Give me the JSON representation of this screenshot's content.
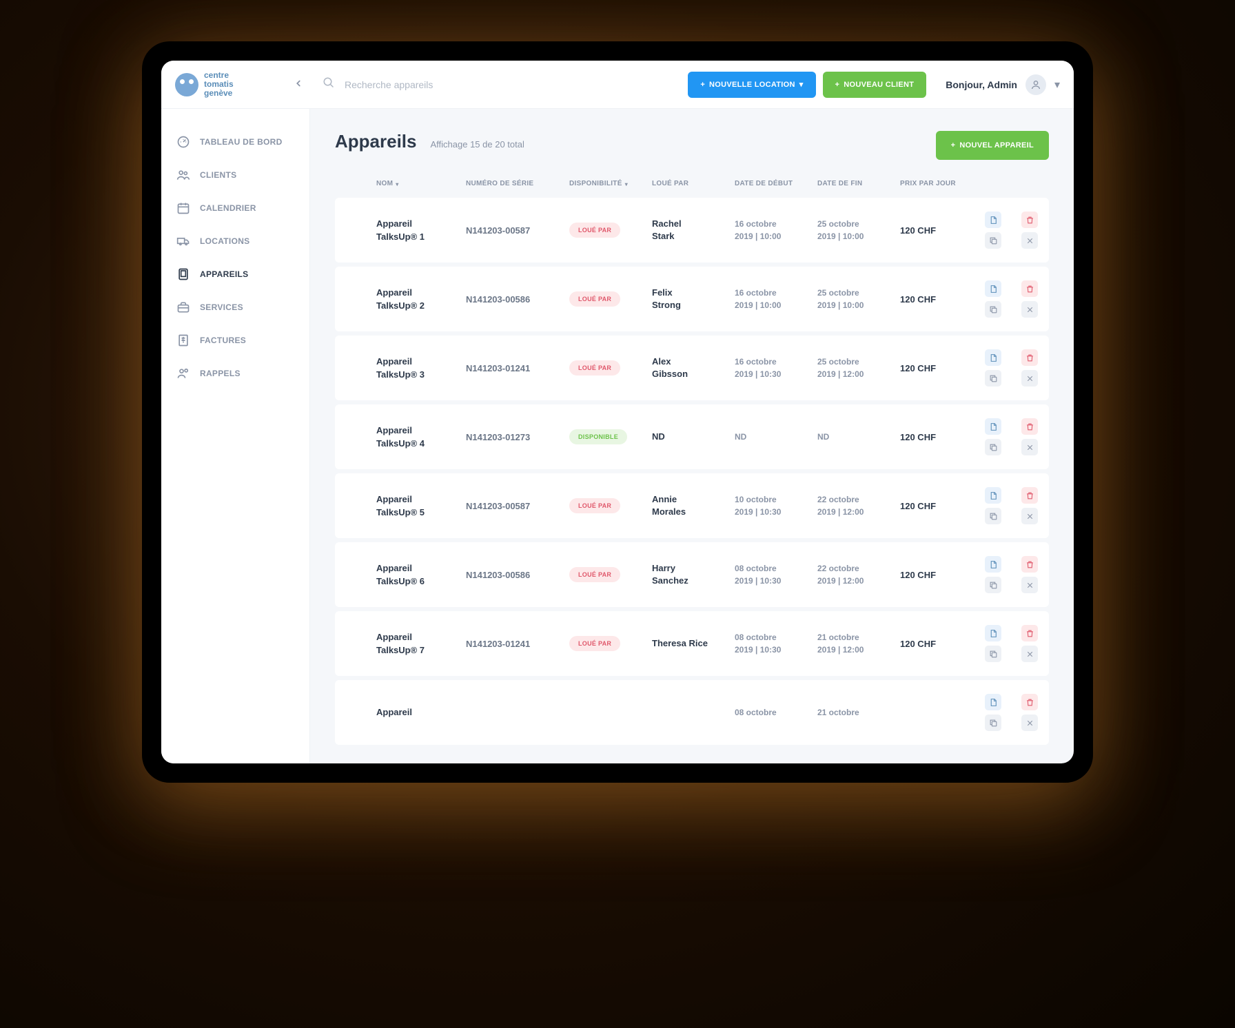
{
  "brand": {
    "line1": "centre",
    "line2": "tomatis",
    "line3": "genève"
  },
  "search": {
    "placeholder": "Recherche appareils"
  },
  "header_buttons": {
    "new_location": "NOUVELLE LOCATION",
    "new_client": "NOUVEAU CLIENT",
    "new_device": "NOUVEL APPAREIL"
  },
  "user": {
    "greeting": "Bonjour, Admin"
  },
  "sidebar": {
    "items": [
      {
        "label": "TABLEAU DE BORD",
        "icon": "dashboard"
      },
      {
        "label": "CLIENTS",
        "icon": "users"
      },
      {
        "label": "CALENDRIER",
        "icon": "calendar"
      },
      {
        "label": "LOCATIONS",
        "icon": "truck"
      },
      {
        "label": "APPAREILS",
        "icon": "device",
        "active": true
      },
      {
        "label": "SERVICES",
        "icon": "briefcase"
      },
      {
        "label": "FACTURES",
        "icon": "invoice"
      },
      {
        "label": "RAPPELS",
        "icon": "bell"
      }
    ]
  },
  "page": {
    "title": "Appareils",
    "subtitle": "Affichage 15 de 20 total"
  },
  "columns": {
    "nom": "NOM",
    "serial": "NUMÉRO DE SÉRIE",
    "dispo": "DISPONIBILITÉ",
    "loue_par": "LOUÉ PAR",
    "date_debut": "DATE DE DÉBUT",
    "date_fin": "DATE DE FIN",
    "prix": "PRIX PAR JOUR"
  },
  "status_labels": {
    "loue": "LOUÉ PAR",
    "dispo": "DISPONIBLE"
  },
  "rows": [
    {
      "color": "#3bc14a",
      "name_l1": "Appareil",
      "name_l2": "TalksUp® 1",
      "serial": "N141203-00587",
      "status": "loue",
      "person_l1": "Rachel",
      "person_l2": "Stark",
      "start_l1": "16 octobre",
      "start_l2": "2019 | 10:00",
      "end_l1": "25 octobre",
      "end_l2": "2019 | 10:00",
      "price": "120 CHF"
    },
    {
      "color": "#f2870c",
      "name_l1": "Appareil",
      "name_l2": "TalksUp® 2",
      "serial": "N141203-00586",
      "status": "loue",
      "person_l1": "Felix",
      "person_l2": "Strong",
      "start_l1": "16 octobre",
      "start_l2": "2019 | 10:00",
      "end_l1": "25 octobre",
      "end_l2": "2019 | 10:00",
      "price": "120 CHF"
    },
    {
      "color": "#8e44ad",
      "name_l1": "Appareil",
      "name_l2": "TalksUp® 3",
      "serial": "N141203-01241",
      "status": "loue",
      "person_l1": "Alex",
      "person_l2": "Gibsson",
      "start_l1": "16 octobre",
      "start_l2": "2019 | 10:30",
      "end_l1": "25 octobre",
      "end_l2": "2019 | 12:00",
      "price": "120 CHF"
    },
    {
      "color": "#2196f3",
      "name_l1": "Appareil",
      "name_l2": "TalksUp® 4",
      "serial": "N141203-01273",
      "status": "dispo",
      "person_l1": "ND",
      "person_l2": "",
      "start_l1": "ND",
      "start_l2": "",
      "end_l1": "ND",
      "end_l2": "",
      "price": "120 CHF"
    },
    {
      "color": "#e74c3c",
      "name_l1": "Appareil",
      "name_l2": "TalksUp® 5",
      "serial": "N141203-00587",
      "status": "loue",
      "person_l1": "Annie",
      "person_l2": "Morales",
      "start_l1": "10 octobre",
      "start_l2": "2019 | 10:30",
      "end_l1": "22 octobre",
      "end_l2": "2019 | 12:00",
      "price": "120 CHF"
    },
    {
      "color": "#bdc3c7",
      "name_l1": "Appareil",
      "name_l2": "TalksUp® 6",
      "serial": "N141203-00586",
      "status": "loue",
      "person_l1": "Harry",
      "person_l2": "Sanchez",
      "start_l1": "08 octobre",
      "start_l2": "2019 | 10:30",
      "end_l1": "22 octobre",
      "end_l2": "2019 | 12:00",
      "price": "120 CHF"
    },
    {
      "color": "#f1c40f",
      "name_l1": "Appareil",
      "name_l2": "TalksUp® 7",
      "serial": "N141203-01241",
      "status": "loue",
      "person_l1": "Theresa Rice",
      "person_l2": "",
      "start_l1": "08 octobre",
      "start_l2": "2019 | 10:30",
      "end_l1": "21 octobre",
      "end_l2": "2019 | 12:00",
      "price": "120 CHF"
    },
    {
      "color": "#16a085",
      "name_l1": "Appareil",
      "name_l2": "",
      "serial": "",
      "status": "",
      "person_l1": "",
      "person_l2": "",
      "start_l1": "08 octobre",
      "start_l2": "",
      "end_l1": "21 octobre",
      "end_l2": "",
      "price": ""
    }
  ]
}
